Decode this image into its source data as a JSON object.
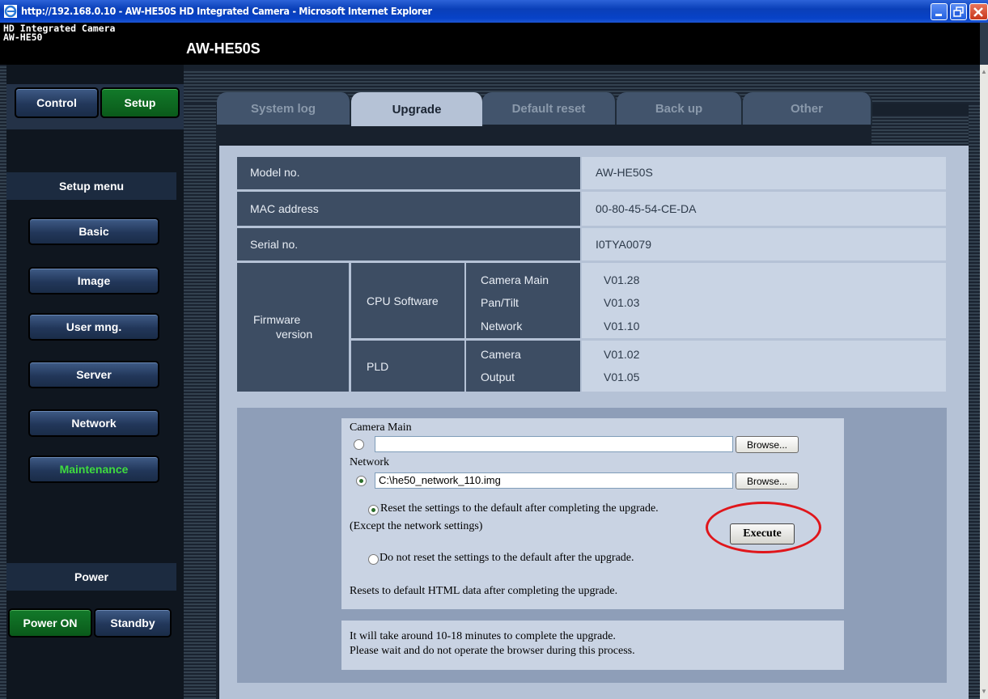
{
  "window": {
    "title": "http://192.168.0.10 - AW-HE50S HD Integrated Camera - Microsoft Internet Explorer"
  },
  "brand": {
    "line1": "HD Integrated Camera",
    "line2": "AW-HE50",
    "model_heading": "AW-HE50S"
  },
  "mode": {
    "control": "Control",
    "setup": "Setup"
  },
  "setup_menu": {
    "heading": "Setup menu",
    "items": [
      "Basic",
      "Image",
      "User mng.",
      "Server",
      "Network",
      "Maintenance"
    ]
  },
  "power": {
    "heading": "Power",
    "on": "Power ON",
    "standby": "Standby"
  },
  "tabs": [
    "System log",
    "Upgrade",
    "Default reset",
    "Back up",
    "Other"
  ],
  "info": {
    "model_label": "Model no.",
    "model_value": "AW-HE50S",
    "mac_label": "MAC address",
    "mac_value": "00-80-45-54-CE-DA",
    "serial_label": "Serial no.",
    "serial_value": "I0TYA0079",
    "firmware_label_1": "Firmware",
    "firmware_label_2": "version",
    "cpu_label": "CPU Software",
    "cpu_rows": [
      {
        "name": "Camera Main",
        "value": "V01.28"
      },
      {
        "name": "Pan/Tilt",
        "value": "V01.03"
      },
      {
        "name": "Network",
        "value": "V01.10"
      }
    ],
    "pld_label": "PLD",
    "pld_rows": [
      {
        "name": "Camera",
        "value": "V01.02"
      },
      {
        "name": "Output",
        "value": "V01.05"
      }
    ]
  },
  "upgrade": {
    "camera_main_label": "Camera Main",
    "camera_main_value": "",
    "network_label": "Network",
    "network_value": "C:\\he50_network_110.img",
    "browse": "Browse...",
    "reset_option": "Reset the settings to the default after completing the upgrade.",
    "reset_note": "(Except the network settings)",
    "execute": "Execute",
    "no_reset_option": "Do not reset the settings to the default after the upgrade.",
    "html_note": "Resets to default HTML data after completing the upgrade.",
    "wait_line1": "It will take around 10-18 minutes to complete the upgrade.",
    "wait_line2": "Please wait and do not operate the browser during this process."
  }
}
